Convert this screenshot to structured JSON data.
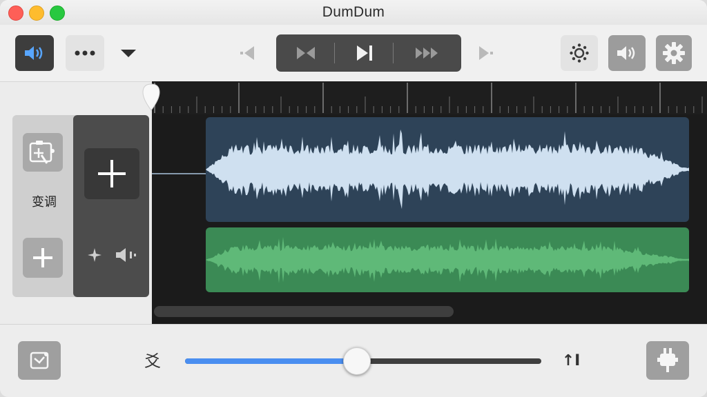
{
  "window": {
    "title": "DumDum"
  },
  "toolbar": {
    "speaker_icon": "speaker-icon",
    "more_icon": "ellipsis-icon",
    "dropdown_icon": "triangle-down-icon",
    "transport": [
      "skip-back-icon",
      "play-pause-icon",
      "fast-forward-icon"
    ],
    "right_icons": [
      "gear-dots-icon",
      "volume-icon",
      "settings-gear-icon"
    ]
  },
  "side_panel": {
    "pitch_label": "变调",
    "pitch_icon": "pitch-image-icon",
    "add_icon": "plus-icon"
  },
  "tracks": [
    {
      "name": "",
      "color": "#2e4358",
      "wave_color": "#cfe0f0"
    },
    {
      "name": "",
      "color": "#3b8a55",
      "wave_color": "#5fb978"
    }
  ],
  "bottom": {
    "left_icon_text": "爻",
    "right_icon_text": "↑I",
    "slider_value": 0.48
  },
  "colors": {
    "accent": "#4a8ef0"
  }
}
